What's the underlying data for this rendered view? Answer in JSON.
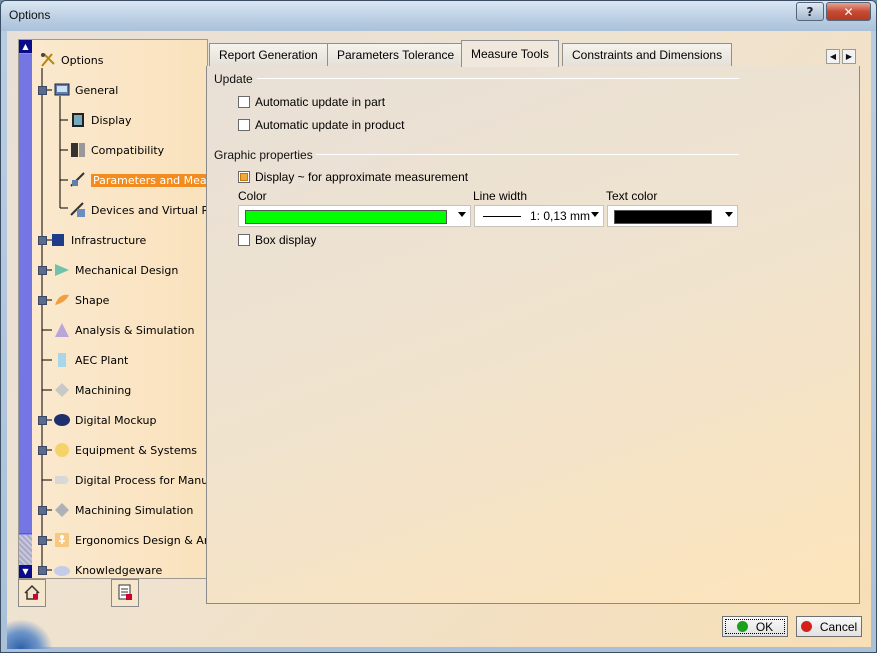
{
  "window": {
    "title": "Options",
    "help_label": "?",
    "close_label": "✕"
  },
  "tree": {
    "items": [
      {
        "label": "Options",
        "icon": "options-icon"
      },
      {
        "label": "General",
        "icon": "general-icon"
      },
      {
        "label": "Display",
        "icon": "display-icon"
      },
      {
        "label": "Compatibility",
        "icon": "compatibility-icon"
      },
      {
        "label": "Parameters and Measure",
        "icon": "parameters-icon",
        "selected": true
      },
      {
        "label": "Devices and Virtual Reality",
        "icon": "devices-icon"
      },
      {
        "label": "Infrastructure",
        "icon": "infrastructure-icon"
      },
      {
        "label": "Mechanical Design",
        "icon": "mechanical-design-icon"
      },
      {
        "label": "Shape",
        "icon": "shape-icon"
      },
      {
        "label": "Analysis & Simulation",
        "icon": "analysis-icon"
      },
      {
        "label": "AEC Plant",
        "icon": "aec-plant-icon"
      },
      {
        "label": "Machining",
        "icon": "machining-icon"
      },
      {
        "label": "Digital Mockup",
        "icon": "digital-mockup-icon"
      },
      {
        "label": "Equipment & Systems",
        "icon": "equipment-icon"
      },
      {
        "label": "Digital Process for Manufacturing",
        "icon": "digital-process-icon"
      },
      {
        "label": "Machining Simulation",
        "icon": "machining-simulation-icon"
      },
      {
        "label": "Ergonomics Design & Analysis",
        "icon": "ergonomics-icon"
      },
      {
        "label": "Knowledgeware",
        "icon": "knowledgeware-icon"
      }
    ],
    "scroll_up": "▲",
    "scroll_down": "▼"
  },
  "tabs": [
    {
      "label": "Report Generation"
    },
    {
      "label": "Parameters Tolerance"
    },
    {
      "label": "Measure Tools",
      "active": true
    },
    {
      "label": "Constraints and Dimensions"
    }
  ],
  "tab_scroll": {
    "left": "◀",
    "right": "▶"
  },
  "update": {
    "title": "Update",
    "auto_part": {
      "label": "Automatic update in part",
      "checked": false
    },
    "auto_product": {
      "label": "Automatic update in product",
      "checked": false
    }
  },
  "graphic": {
    "title": "Graphic properties",
    "display_approx": {
      "label": "Display ~ for approximate measurement",
      "checked": true
    },
    "color_label": "Color",
    "line_width_label": "Line width",
    "text_color_label": "Text color",
    "color_value": "#00ff00",
    "line_width_value": "1: 0,13 mm",
    "text_color_value": "#000000",
    "box_display": {
      "label": "Box display",
      "checked": false
    }
  },
  "buttons": {
    "ok": "OK",
    "cancel": "Cancel",
    "ok_color": "#1aa01a",
    "cancel_color": "#d8201a"
  }
}
